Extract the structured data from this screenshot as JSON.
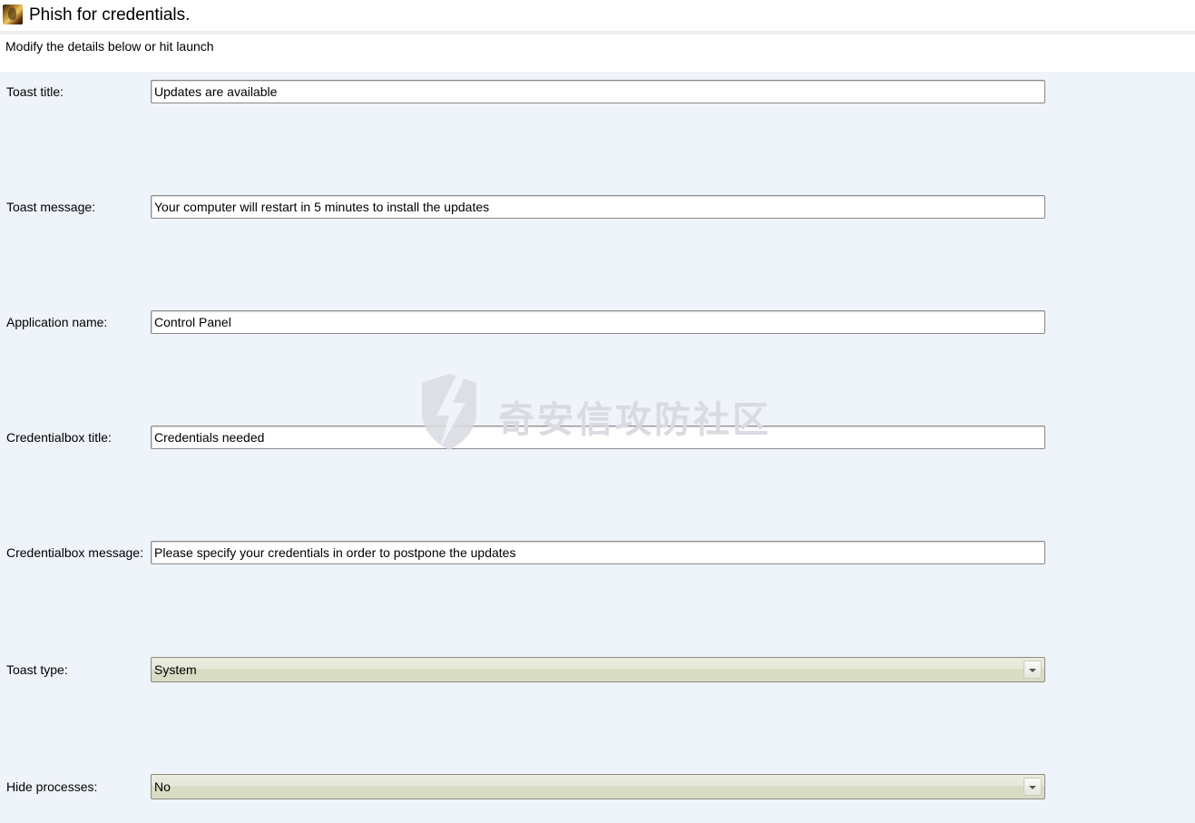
{
  "window": {
    "title": "Phish for credentials.",
    "icon": "app-icon"
  },
  "intro": {
    "text": "Modify the details below or hit launch"
  },
  "fields": {
    "toast_title": {
      "label": "Toast title:",
      "value": "Updates are available"
    },
    "toast_message": {
      "label": "Toast message:",
      "value": "Your computer will restart in 5 minutes to install the updates"
    },
    "application_name": {
      "label": "Application name:",
      "value": "Control Panel"
    },
    "credentialbox_title": {
      "label": "Credentialbox title:",
      "value": "Credentials needed"
    },
    "credentialbox_message": {
      "label": "Credentialbox message:",
      "value": "Please specify your credentials in order to postpone the updates"
    },
    "toast_type": {
      "label": "Toast type:",
      "selected": "System"
    },
    "hide_processes": {
      "label": "Hide processes:",
      "selected": "No"
    }
  },
  "watermark": {
    "text": "奇安信攻防社区",
    "icon": "shield-lightning-icon"
  },
  "colors": {
    "content_background": "#eff3fa",
    "select_background": "#e6e9d9"
  }
}
